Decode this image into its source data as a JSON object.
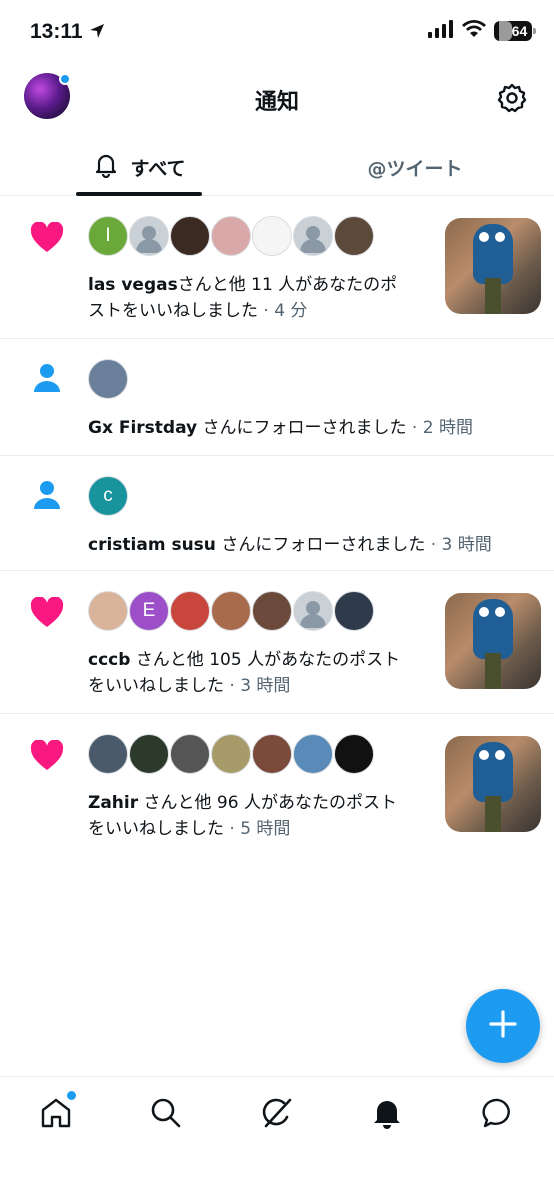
{
  "status_bar": {
    "time": "13:11",
    "battery": "64"
  },
  "header": {
    "title": "通知"
  },
  "tabs": [
    {
      "label": "すべて",
      "active": true
    },
    {
      "label": "@ツイート",
      "active": false
    }
  ],
  "notifications": [
    {
      "type": "like",
      "name": "las vegas",
      "text_line1": "さんと他 11 人があなたのポ",
      "text_line2": "ストをいいねしました",
      "time": "· 4 分",
      "avatars": [
        "I",
        "",
        "",
        "",
        "",
        "",
        ""
      ]
    },
    {
      "type": "follow",
      "name": "Gx Firstday",
      "text": "さんにフォローされました",
      "time": "· 2 時間",
      "avatars": [
        ""
      ]
    },
    {
      "type": "follow",
      "name": "cristiam susu",
      "text": "さんにフォローされました",
      "time": "· 3 時間",
      "avatars": [
        "c"
      ]
    },
    {
      "type": "like",
      "name": "cccb",
      "text_line1": "さんと他 105 人があなたのポスト",
      "text_line2": "をいいねしました",
      "time": "· 3 時間",
      "avatars": [
        "",
        "E",
        "",
        "",
        "",
        "",
        ""
      ]
    },
    {
      "type": "like",
      "name": "Zahir",
      "text_line1": "さんと他 96 人があなたのポスト",
      "text_line2": "をいいねしました",
      "time": "· 5 時間",
      "avatars": [
        "",
        "",
        "",
        "",
        "",
        "",
        ""
      ]
    }
  ],
  "colors": {
    "accent": "#1d9bf0",
    "like": "#f91880",
    "text": "#0f1419",
    "secondary": "#536471"
  },
  "bottom_nav": [
    "home-icon",
    "search-icon",
    "grok-icon",
    "bell-icon",
    "messages-icon"
  ]
}
